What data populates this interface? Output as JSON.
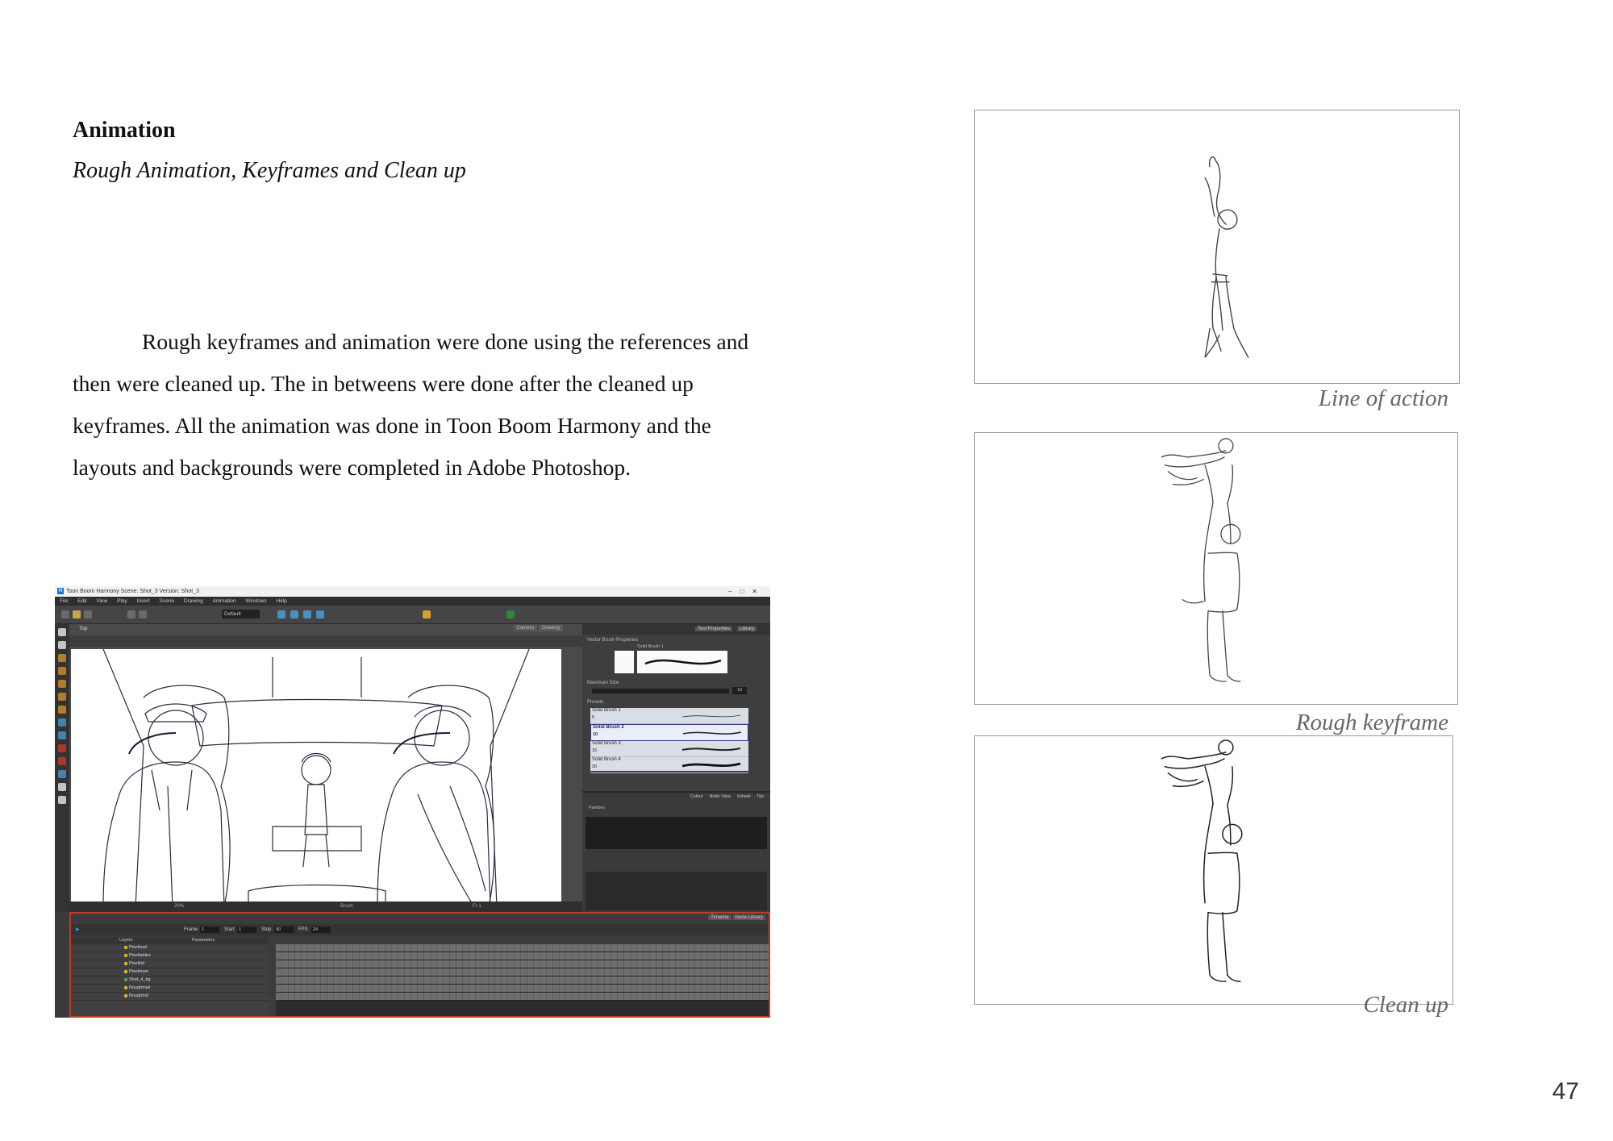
{
  "heading": "Animation",
  "subheading": "Rough Animation, Keyframes and Clean up",
  "paragraph": "Rough keyframes and animation were done using the references and then were cleaned up. The in betweens were done after the cleaned up keyframes. All the animation was done in Toon Boom Harmony and the layouts and backgrounds were completed in Adobe Photoshop.",
  "frames": [
    {
      "caption": "Line of action"
    },
    {
      "caption": "Rough keyframe"
    },
    {
      "caption": "Clean up"
    }
  ],
  "page_number": "47",
  "screenshot": {
    "logo_letter": "H",
    "window_title": "Toon Boom Harmony Scene: Shot_3 Version: Shot_3",
    "menu": [
      "File",
      "Edit",
      "View",
      "Play",
      "Insert",
      "Scene",
      "Drawing",
      "Animation",
      "Windows",
      "Help"
    ],
    "workspace_select": "Default",
    "view_tab": "Top",
    "view_tabs": [
      "Camera",
      "Drawing"
    ],
    "status_tool": "Brush",
    "status_zoom": "20%",
    "status_frame": "Fr 1",
    "right_tabs": [
      "Tool Properties",
      "Library"
    ],
    "tool_properties_title": "Vector Brush Properties",
    "brush_name": "Solid Brush 1",
    "max_size_label": "Maximum Size",
    "max_size_value": "10",
    "presets_label": "Presets",
    "presets": [
      {
        "name": "Solid Brush 1",
        "size": "5"
      },
      {
        "name": "Solid Brush 2",
        "size": "10"
      },
      {
        "name": "Solid Brush 3",
        "size": "15"
      },
      {
        "name": "Solid Brush 4",
        "size": "20"
      }
    ],
    "colour_tabs": [
      "Colour",
      "Node View",
      "Xsheet",
      "Top"
    ],
    "palettes_label": "Palettes",
    "timeline_tabs": [
      "Timeline",
      "Node Library"
    ],
    "frame_label": "Frame",
    "frame_value": "1",
    "start_label": "Start",
    "start_value": "1",
    "stop_label": "Stop",
    "stop_value": "90",
    "fps_label": "FPS",
    "fps_value": "24",
    "layers_header": "Layers",
    "params_header": "Parameters",
    "layers": [
      "Pixelmail",
      "Pixeltables",
      "Pixelkid",
      "Pixelmum",
      "Shot_4_bg",
      "Roughmail",
      "Roughmd"
    ]
  },
  "colors": {
    "frame_border": "#9a9a9a",
    "caption": "#666666",
    "timeline_highlight": "#c0392b"
  }
}
